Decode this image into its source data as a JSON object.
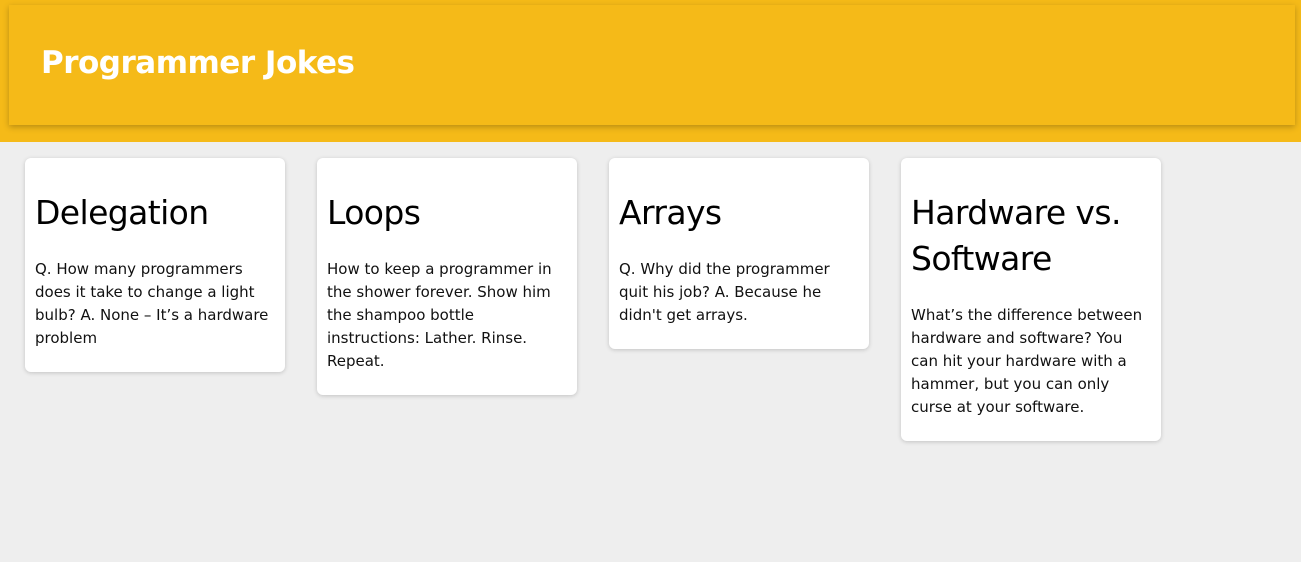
{
  "header": {
    "title": "Programmer Jokes"
  },
  "colors": {
    "header_bg": "#f5ba18",
    "page_bg": "#eeeeee",
    "card_bg": "#ffffff"
  },
  "cards": [
    {
      "title": "Delegation",
      "body": "Q. How many programmers does it take to change a light bulb? A. None – It’s a hardware problem"
    },
    {
      "title": "Loops",
      "body": "How to keep a programmer in the shower forever. Show him the shampoo bottle instructions: Lather. Rinse. Repeat."
    },
    {
      "title": "Arrays",
      "body": "Q. Why did the programmer quit his job? A. Because he didn't get arrays."
    },
    {
      "title": "Hardware vs. Software",
      "body": "What’s the difference between hardware and software? You can hit your hardware with a hammer, but you can only curse at your software."
    }
  ]
}
